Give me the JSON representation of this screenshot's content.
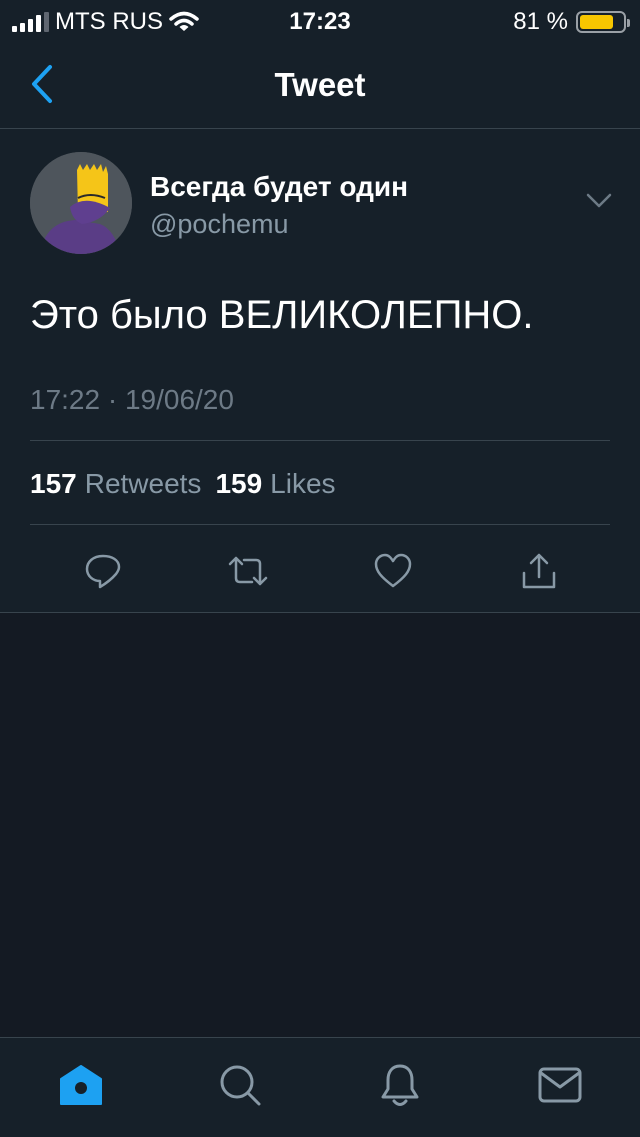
{
  "status_bar": {
    "carrier": "MTS RUS",
    "time": "17:23",
    "battery": "81 %",
    "battery_level": 0.81
  },
  "nav": {
    "title": "Tweet",
    "back_icon": "chevron-left-icon"
  },
  "tweet": {
    "display_name": "Всегда будет один",
    "handle": "@pochemu",
    "text": "Это было ВЕЛИКОЛЕПНО.",
    "timestamp": "17:22 · 19/06/20",
    "retweets_count": "157",
    "retweets_label": "Retweets",
    "likes_count": "159",
    "likes_label": "Likes"
  },
  "actions": [
    "reply-icon",
    "retweet-icon",
    "like-icon",
    "share-icon"
  ],
  "tabs": [
    "home-icon",
    "search-icon",
    "notifications-icon",
    "messages-icon"
  ],
  "colors": {
    "accent": "#1da1f2",
    "background": "#162029",
    "secondary_text": "#8899a6",
    "battery": "#f7c600"
  }
}
